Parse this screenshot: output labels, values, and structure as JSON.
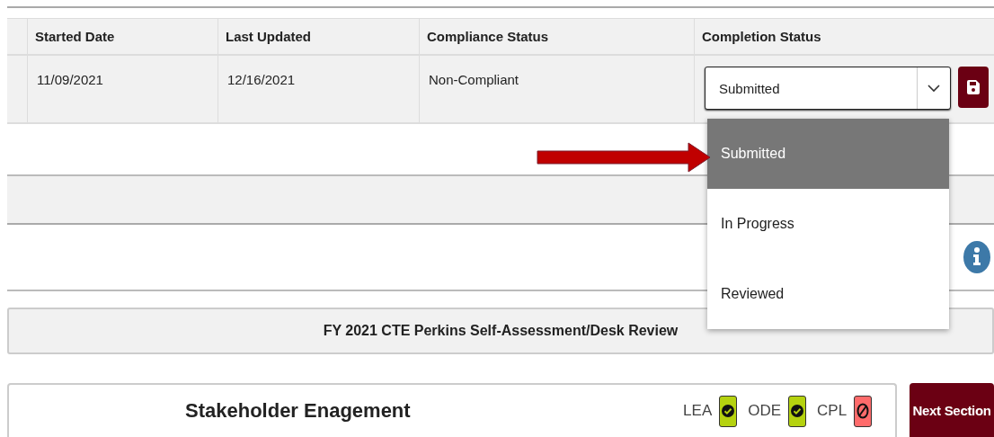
{
  "table": {
    "columns": [
      "Started Date",
      "Last Updated",
      "Compliance Status",
      "Completion Status"
    ],
    "rows": [
      {
        "started_date": "11/09/2021",
        "last_updated": "12/16/2021",
        "compliance_status": "Non-Compliant",
        "completion_status": {
          "value": "Submitted",
          "expanded": true,
          "options": [
            {
              "label": "Submitted",
              "selected": true
            },
            {
              "label": "In Progress",
              "selected": false
            },
            {
              "label": "Reviewed",
              "selected": false
            }
          ]
        }
      }
    ]
  },
  "review_bar": {
    "title": "FY 2021 CTE Perkins Self-Assessment/Desk Review"
  },
  "section": {
    "title": "Stakeholder Enagement",
    "approvals": [
      {
        "label": "LEA",
        "kind": "approved"
      },
      {
        "label": "ODE",
        "kind": "approved"
      },
      {
        "label": "CPL",
        "kind": "rejected"
      }
    ],
    "next_button": "Next Section"
  }
}
